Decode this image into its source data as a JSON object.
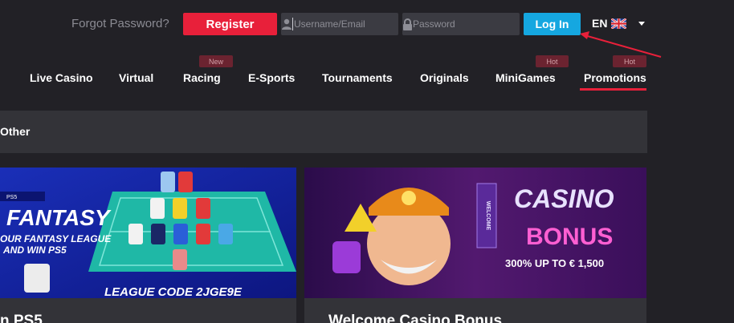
{
  "header": {
    "forgot_password": "Forgot Password?",
    "register_label": "Register",
    "username_placeholder": "Username/Email",
    "password_placeholder": "Password",
    "login_label": "Log In",
    "language_code": "EN"
  },
  "nav": {
    "items": [
      {
        "label": "Live Casino"
      },
      {
        "label": "Virtual"
      },
      {
        "label": "Racing",
        "badge": "New"
      },
      {
        "label": "E-Sports"
      },
      {
        "label": "Tournaments"
      },
      {
        "label": "Originals"
      },
      {
        "label": "MiniGames",
        "badge": "Hot"
      },
      {
        "label": "Promotions",
        "badge": "Hot",
        "active": true
      }
    ]
  },
  "section": {
    "title": "Other"
  },
  "promos": [
    {
      "title": "n PS5",
      "banner": {
        "headline": "FANTASY",
        "line1": "OUR FANTASY LEAGUE",
        "line2": "AND WIN PS5",
        "code": "LEAGUE CODE 2JGE9E",
        "logo": "PS5"
      }
    },
    {
      "title": "Welcome Casino Bonus",
      "banner": {
        "vertical": "WELCOME",
        "headline1": "CASINO",
        "headline2": "BONUS",
        "subline": "300% UP TO € 1,500"
      }
    }
  ],
  "colors": {
    "background": "#222126",
    "accent_red": "#e8203a",
    "login_blue": "#15a7e0",
    "badge_bg": "#6b2330",
    "panel": "#333338"
  }
}
